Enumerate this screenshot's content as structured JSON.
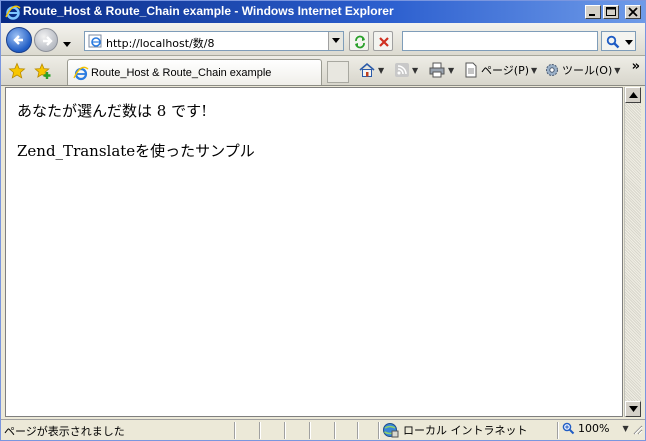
{
  "window": {
    "title": "Route_Host & Route_Chain example - Windows Internet Explorer"
  },
  "address_bar": {
    "url": "http://localhost/数/8",
    "search_placeholder": ""
  },
  "tabs": [
    {
      "label": "Route_Host & Route_Chain example"
    }
  ],
  "command_bar": {
    "page_label": "ページ(P)",
    "tools_label": "ツール(O)",
    "more": "»"
  },
  "content": {
    "line1": "あなたが選んだ数は 8 です!",
    "line2": "Zend_Translateを使ったサンプル"
  },
  "status_bar": {
    "message": "ページが表示されました",
    "zone": "ローカル イントラネット",
    "zoom": "100%"
  },
  "colors": {
    "titlebar": "#2c5fcf",
    "content_bg": "#ffffff"
  }
}
